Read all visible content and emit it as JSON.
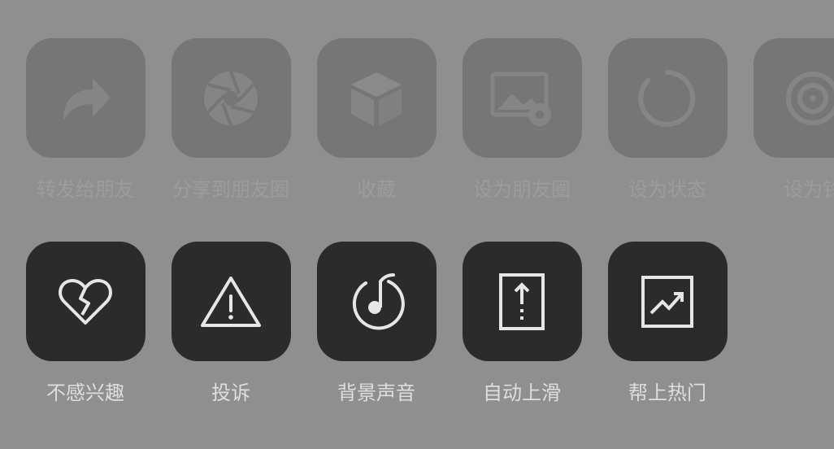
{
  "share_row": {
    "items": [
      {
        "label": "转发给朋友",
        "icon": "forward-arrow-icon"
      },
      {
        "label": "分享到朋友圈",
        "icon": "moments-aperture-icon"
      },
      {
        "label": "收藏",
        "icon": "favorite-cube-icon"
      },
      {
        "label": "设为朋友圈",
        "icon": "moments-cover-image-icon"
      },
      {
        "label": "设为状态",
        "icon": "status-ring-icon"
      },
      {
        "label": "设为铃",
        "icon": "ringtone-icon"
      }
    ]
  },
  "action_row": {
    "items": [
      {
        "label": "不感兴趣",
        "icon": "broken-heart-icon"
      },
      {
        "label": "投诉",
        "icon": "warning-triangle-icon"
      },
      {
        "label": "背景声音",
        "icon": "music-note-circle-icon"
      },
      {
        "label": "自动上滑",
        "icon": "auto-scroll-up-icon"
      },
      {
        "label": "帮上热门",
        "icon": "trending-up-icon"
      }
    ]
  },
  "colors": {
    "background": "#8f8f8f",
    "disabled_tile": "#767676",
    "active_tile": "#2b2b2b",
    "active_label": "#dedede",
    "disabled_label": "#9c9c9c",
    "icon_stroke": "#e6e6e6"
  }
}
